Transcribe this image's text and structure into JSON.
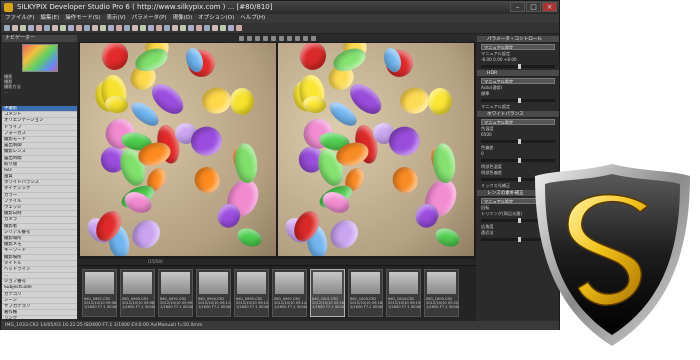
{
  "window": {
    "title": "SILKYPIX Developer Studio Pro 6 ( http://www.silkypix.com ) ... [#80/810]",
    "buttons": [
      "–",
      "□",
      "×"
    ]
  },
  "menu": [
    "ファイル(F)",
    "編集(E)",
    "操作モード(S)",
    "表示(V)",
    "パラメータ(P)",
    "現像(D)",
    "オプション(O)",
    "ヘルプ(H)"
  ],
  "left_panel": {
    "navigator_title": "ナビゲーター",
    "info_lines": [
      "撮影",
      "撮影",
      "撮影方法",
      "..."
    ],
    "list": [
      "手撮影",
      "コメント",
      "オリエンテーション",
      "ドライブ",
      "フォーカス",
      "撮影モード",
      "露出制御",
      "撮影レンズ",
      "露出時間",
      "絞り値",
      "ISO",
      "画質",
      "ホワイトバランス",
      "ダイナミック",
      "カラー",
      "ファイル",
      "ウェッジ",
      "撮影日時",
      "カメラ",
      "撮影者",
      "シリアル番号",
      "撮影場所",
      "撮影メモ",
      "キーワード",
      "撮影場所",
      "タイトル",
      "ヘッドライン",
      "...",
      "ジョブ番号",
      "SubjectCode",
      "カテゴリ",
      "シーン",
      "サブカテゴリ",
      "著作権",
      "リンク",
      "州",
      "追加カテゴリ",
      "キーワード",
      "撮影地名",
      "撮影地市",
      "プロバイダー",
      "撮影者"
    ],
    "selected_index": 0
  },
  "viewer": {
    "status": "(15/50)"
  },
  "filmstrip": [
    {
      "name": "IMG_0987.CR2",
      "date": "2012/10/10 09:06:45",
      "exif": "1/1600 F7.1 ISO400"
    },
    {
      "name": "IMG_0990.CR2",
      "date": "2012/10/10 09:08:22",
      "exif": "1/1600 F7.1 ISO400"
    },
    {
      "name": "IMG_0992.CR2",
      "date": "2012/10/10 09:09:10",
      "exif": "1/1600 F7.1 ISO400"
    },
    {
      "name": "IMG_0994.CR2",
      "date": "2012/10/10 09:11:05",
      "exif": "1/1600 F7.1 ISO400"
    },
    {
      "name": "IMG_0995.CR2",
      "date": "2012/10/10 09:12:31",
      "exif": "1/1600 F7.1 ISO400"
    },
    {
      "name": "IMG_0997.CR2",
      "date": "2012/10/10 09:14:02",
      "exif": "1/1600 F7.1 ISO400"
    },
    {
      "name": "IMG_1001.CR2",
      "date": "2012/10/10 09:16:44",
      "exif": "1/1600 F7.1 ISO400"
    },
    {
      "name": "IMG_1003.CR2",
      "date": "2012/10/10 09:18:20",
      "exif": "1/1600 F7.1 ISO400"
    },
    {
      "name": "IMG_1004.CR2",
      "date": "2012/10/10 09:19:05",
      "exif": "1/1600 F7.1 ISO400"
    },
    {
      "name": "IMG_1005.CR2",
      "date": "2012/10/10 09:20:40",
      "exif": "1/1600 F7.1 ISO400"
    }
  ],
  "right_panel": {
    "sections": [
      {
        "title": "パラメータ・コントロール",
        "rows": [
          "マニュアル設定",
          "-8.00    0.00    +8.00"
        ],
        "select": "マニュアル設定"
      },
      {
        "title": "HDR",
        "rows": [
          "Auto(通常)",
          "標準",
          "マニュアル設定"
        ],
        "select": "マニュアル設定"
      },
      {
        "title": "ホワイトバランス",
        "rows": [
          "色温度",
          "6500",
          "色偏差",
          "0",
          "明部色温度",
          "明部色偏差",
          "ミックス光補正"
        ],
        "select": "マニュアル設定"
      },
      {
        "title": "レンズの素朴補正",
        "rows": [
          "回転",
          "トリミング(周辺光量)",
          "広角度",
          "遠近法"
        ],
        "select": "マニュアル設定"
      }
    ]
  },
  "statusbar": "IMG_1033.CR2  14/05/03 16:22:25  ISO400  F7.1  1/1600  EV:0.00  Av(Manual)  f=50.0mm"
}
